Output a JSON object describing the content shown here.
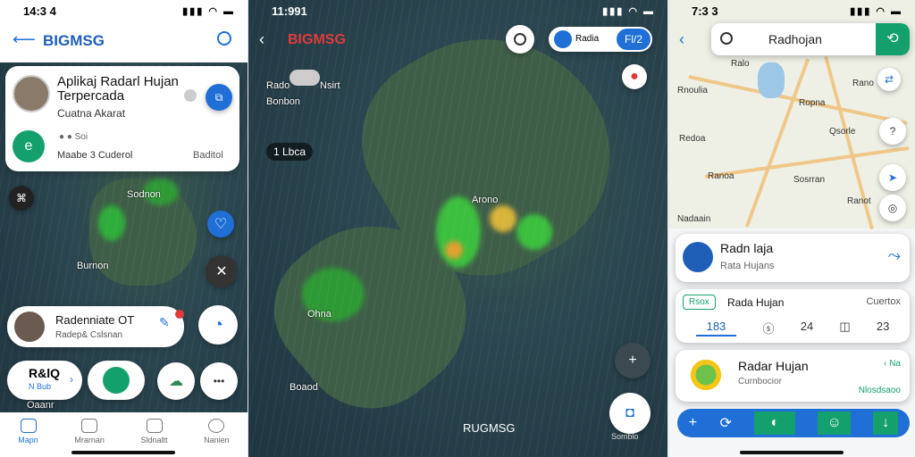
{
  "left": {
    "status_time": "14:3 4",
    "status_icons": "▮▮▮ ◠ ▬",
    "header_title": "BIGMSG",
    "info_card": {
      "title": "Aplikaj Radarl Hujan Terpercada",
      "subtitle": "Cuatna Akarat",
      "meta": "Maabe 3 Cuderol",
      "meta2": "Baditol",
      "tag": "Soi"
    },
    "map_labels": [
      "Sodnon",
      "Burnon",
      "Oaanr"
    ],
    "radar_card": {
      "title": "Radenniate OT",
      "subtitle": "Radep& Cslsnan"
    },
    "pill_left": {
      "line1": "R&lQ",
      "line2": "N Bub"
    },
    "bottom_nav": [
      {
        "label": "Mapn",
        "icon": "home-icon",
        "active": true
      },
      {
        "label": "Mrarnan",
        "icon": "chat-icon",
        "active": false
      },
      {
        "label": "Sldnaltt",
        "icon": "bell-icon",
        "active": false
      },
      {
        "label": "Nanien",
        "icon": "profile-icon",
        "active": false
      }
    ]
  },
  "middle": {
    "status_time": "11:991",
    "status_icons": "▮▮▮ ◠ ▬",
    "header_title": "BIGMSG",
    "toggle_label": "Radia",
    "toggle_value": "Fl/2",
    "map_labels": [
      "Rado",
      "Nsirt",
      "Bonbon",
      "Arono",
      "Ohna",
      "Boaod"
    ],
    "time_chip": "1 Lbca",
    "bottom_label": "RUGMSG",
    "corner_label": "Somblo"
  },
  "right": {
    "status_time": "7:3 3",
    "status_icons": "▮▮▮ ◠ ▬",
    "search_value": "Radhojan",
    "map_labels": [
      "Ralo",
      "Rnoulia",
      "Ropna",
      "Rano",
      "Qsorle",
      "Redoa",
      "Ranoa",
      "Sosrran",
      "Ranot",
      "Nadaain"
    ],
    "radar_card": {
      "title": "Radn laja",
      "subtitle": "Rata Hujans"
    },
    "stats_card": {
      "badge": "Rsox",
      "title": "Rada Hujan",
      "right": "Cuertox",
      "tabs": [
        "183",
        "ⓢ",
        "24",
        "◫",
        "23"
      ]
    },
    "weather_card": {
      "title": "Radar Hujan",
      "subtitle": "Curnbocior",
      "action": "Nlosdsaoo",
      "badge": "‹ Na"
    },
    "bottom_bar": [
      "+",
      "⟳",
      "◐",
      "☺",
      "↓"
    ]
  },
  "colors": {
    "accent_blue": "#1f6fd6",
    "accent_green": "#14a06d",
    "red": "#e03a3a"
  }
}
